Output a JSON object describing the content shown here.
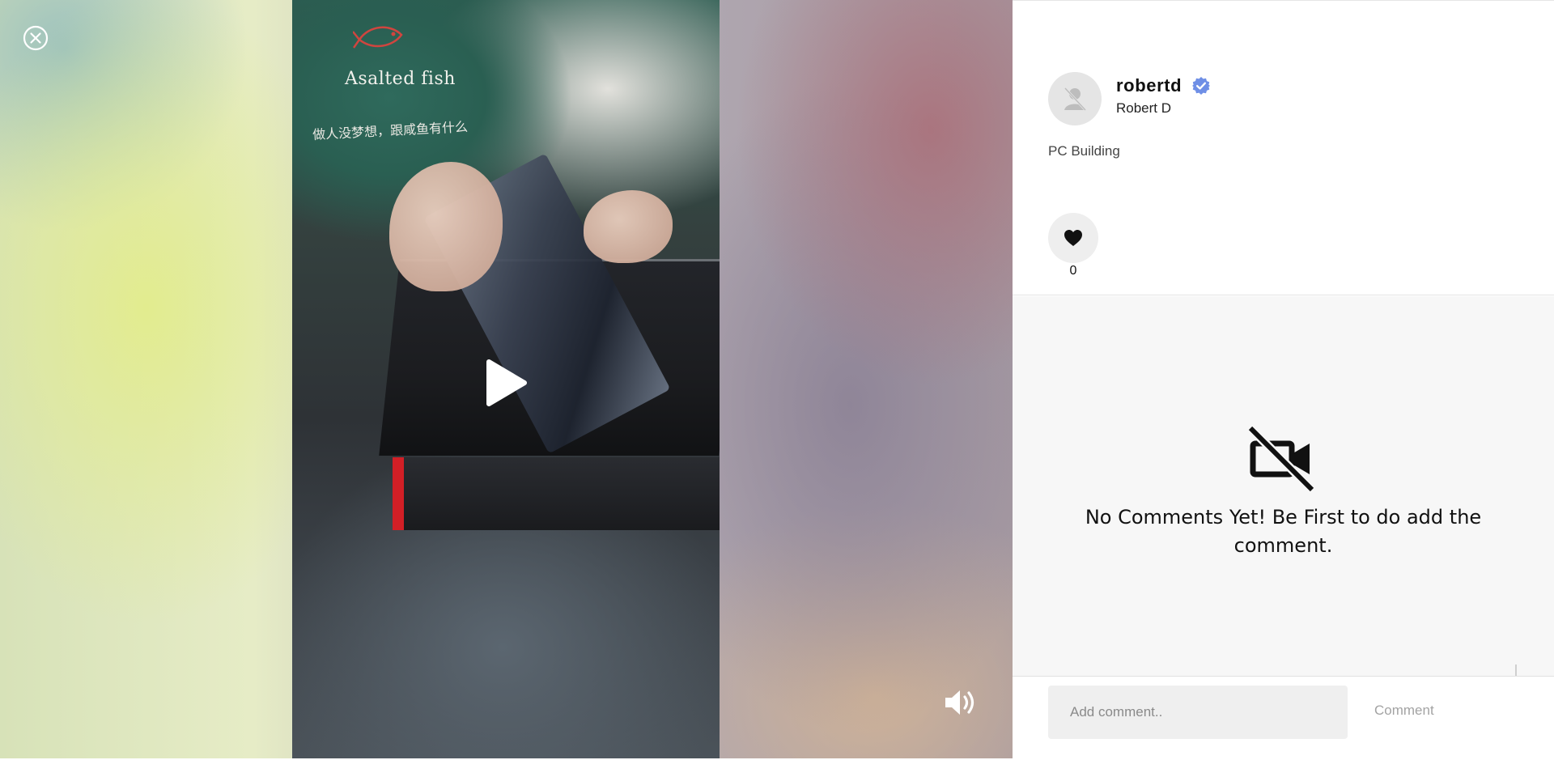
{
  "viewer": {
    "close_icon": "close-circle-icon",
    "play_icon": "play-icon",
    "volume_icon": "volume-icon",
    "video_shirt_text": "Asalted fish",
    "video_shirt_subtext": "做人没梦想，跟咸鱼有什么"
  },
  "profile": {
    "username": "robertd",
    "verified": true,
    "full_name": "Robert D",
    "category": "PC Building",
    "avatar_icon": "default-avatar-icon",
    "verified_icon": "verified-badge-icon"
  },
  "likes": {
    "icon": "heart-icon",
    "count": "0"
  },
  "comments": {
    "empty_icon": "video-off-icon",
    "empty_message": "No Comments Yet! Be First to do add the comment.",
    "input_placeholder": "Add comment..",
    "input_value": "",
    "submit_label": "Comment"
  },
  "colors": {
    "verified_badge": "#6f8fe6",
    "panel_background": "#ffffff",
    "comments_background": "#f7f7f7",
    "input_background": "#efefef",
    "submit_text": "#a3a3a3"
  }
}
